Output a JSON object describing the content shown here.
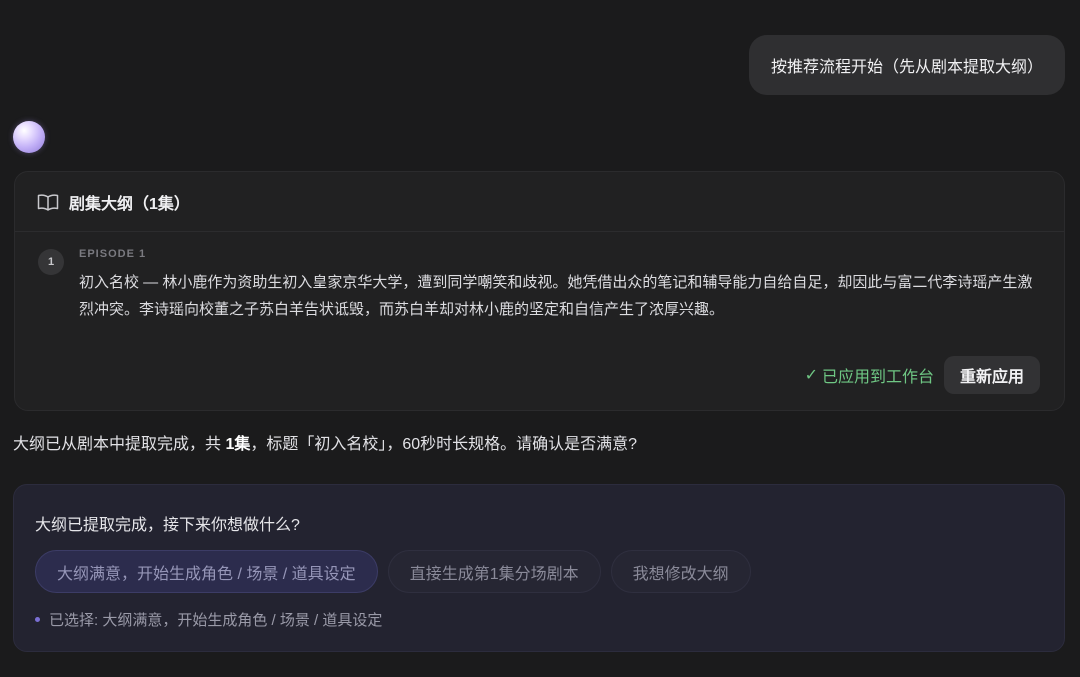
{
  "user_message": "按推荐流程开始（先从剧本提取大纲）",
  "outline_card": {
    "icon": "book-open-icon",
    "title": "剧集大纲（1集）",
    "episode": {
      "number": "1",
      "label": "EPISODE 1",
      "text": "初入名校 — 林小鹿作为资助生初入皇家京华大学，遭到同学嘲笑和歧视。她凭借出众的笔记和辅导能力自给自足，却因此与富二代李诗瑶产生激烈冲突。李诗瑶向校董之子苏白羊告状诋毁，而苏白羊却对林小鹿的坚定和自信产生了浓厚兴趣。"
    },
    "applied_check": "✓",
    "applied_label": "已应用到工作台",
    "reapply_label": "重新应用"
  },
  "assistant_message": {
    "before": "大纲已从剧本中提取完成，共 ",
    "count": "1集",
    "after": "，标题「初入名校」，60秒时长规格。请确认是否满意?"
  },
  "choice": {
    "question": "大纲已提取完成，接下来你想做什么?",
    "options": [
      "大纲满意，开始生成角色 / 场景 / 道具设定",
      "直接生成第1集分场剧本",
      "我想修改大纲"
    ],
    "selected_index": 0,
    "selected_text": "已选择: 大纲满意，开始生成角色 / 场景 / 道具设定"
  },
  "colors": {
    "background": "#1b1b1c",
    "applied_green": "#6fc784",
    "accent_purple": "#7a6fd4"
  }
}
